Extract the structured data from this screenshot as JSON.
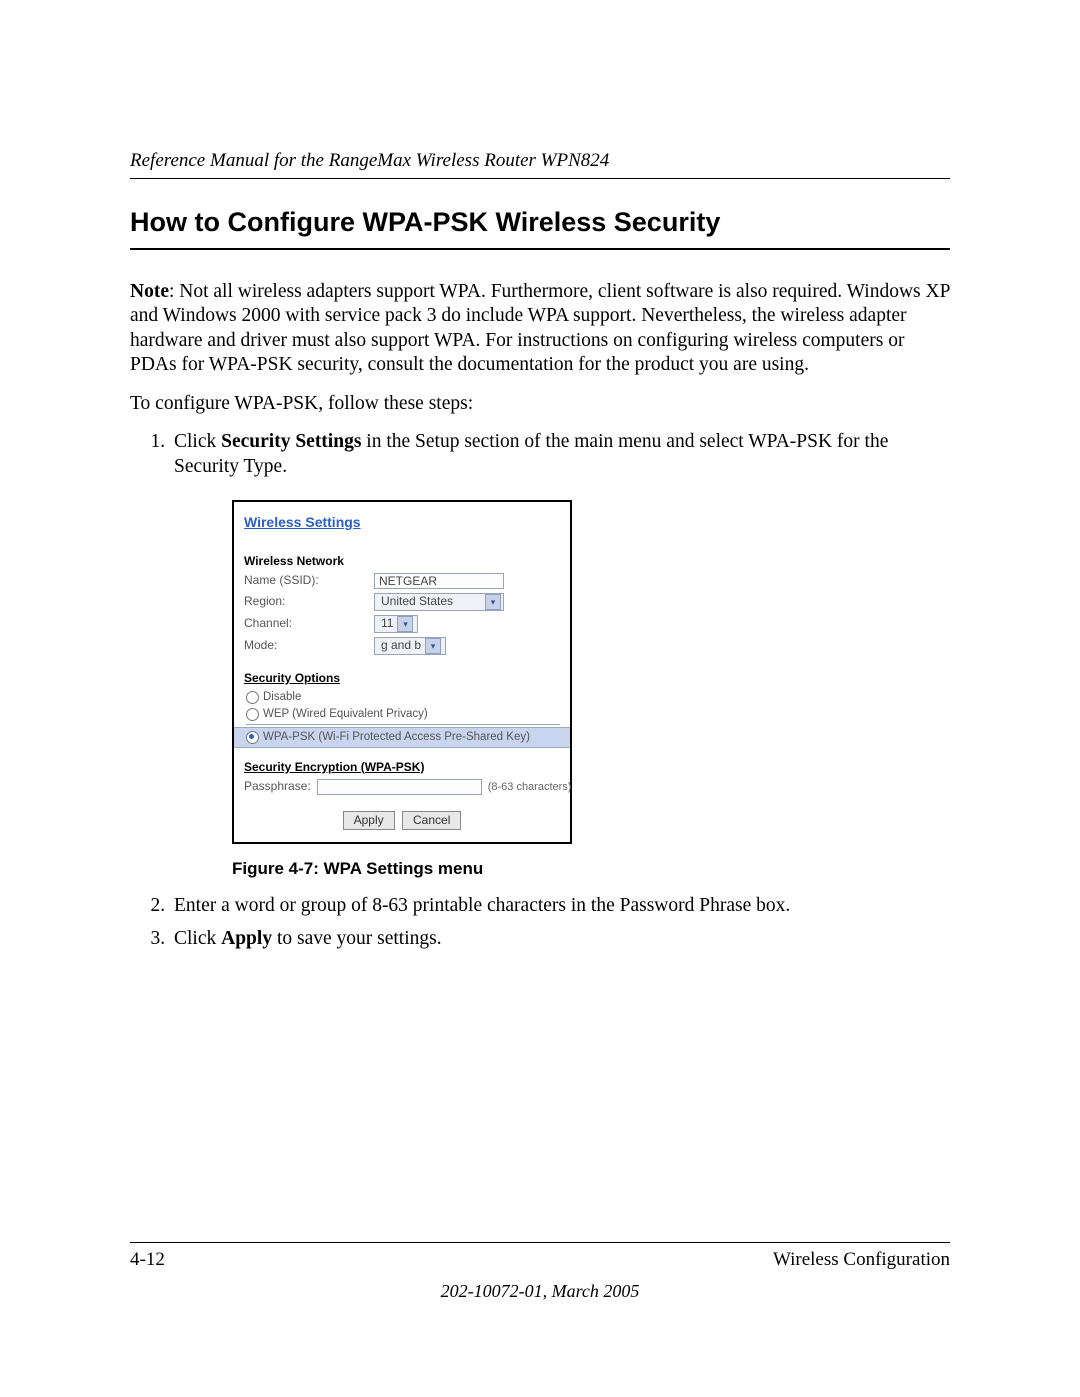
{
  "header": {
    "running_title": "Reference Manual for the RangeMax Wireless Router WPN824"
  },
  "section": {
    "title": "How to Configure WPA-PSK Wireless Security"
  },
  "paragraphs": {
    "note_label": "Note",
    "note_text": ": Not all wireless adapters support WPA. Furthermore, client software is also required. Windows XP and Windows 2000 with service pack 3 do include WPA support. Nevertheless, the wireless adapter hardware and driver must also support WPA. For instructions on configuring wireless computers or PDAs for WPA-PSK security, consult the documentation for the product you are using.",
    "intro": "To configure WPA-PSK, follow these steps:"
  },
  "steps": {
    "s1_pre": "Click ",
    "s1_bold": "Security Settings",
    "s1_post": " in the Setup section of the main menu and select WPA-PSK for the Security Type.",
    "s2": "Enter a word or group of 8-63 printable characters in the Password Phrase box.",
    "s3_pre": "Click ",
    "s3_bold": "Apply",
    "s3_post": " to save your settings."
  },
  "figure": {
    "caption": "Figure 4-7: WPA Settings menu"
  },
  "screenshot": {
    "title": "Wireless Settings",
    "network_label": "Wireless Network",
    "name_label": "Name (SSID):",
    "name_value": "NETGEAR",
    "region_label": "Region:",
    "region_value": "United States",
    "channel_label": "Channel:",
    "channel_value": "11",
    "mode_label": "Mode:",
    "mode_value": "g and b",
    "security_label": "Security Options",
    "opt_disable": "Disable",
    "opt_wep": "WEP (Wired Equivalent Privacy)",
    "opt_wpa": "WPA-PSK (Wi-Fi Protected Access Pre-Shared Key)",
    "enc_label": "Security Encryption (WPA-PSK)",
    "pass_label": "Passphrase:",
    "pass_hint": "(8-63 characters)",
    "btn_apply": "Apply",
    "btn_cancel": "Cancel"
  },
  "footer": {
    "page_number": "4-12",
    "chapter": "Wireless Configuration",
    "doc_id": "202-10072-01, March 2005"
  }
}
